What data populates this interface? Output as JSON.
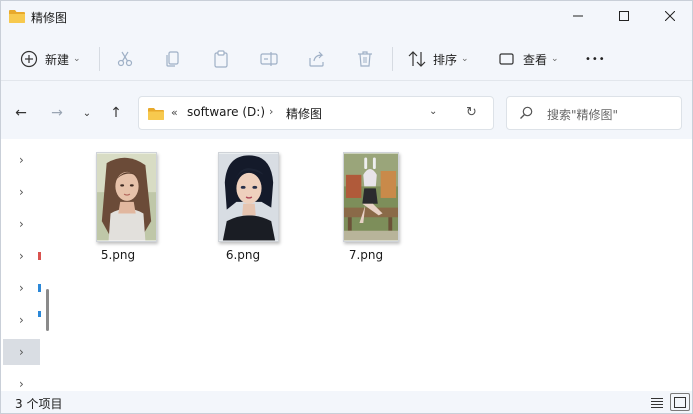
{
  "window": {
    "title": "精修图"
  },
  "commands": {
    "new_label": "新建",
    "sort_label": "排序",
    "view_label": "查看",
    "more_label": "•••"
  },
  "address": {
    "overflow": "«",
    "crumbs": [
      "software (D:)",
      "精修图"
    ]
  },
  "search": {
    "placeholder": "搜索\"精修图\""
  },
  "files": [
    {
      "name": "5.png"
    },
    {
      "name": "6.png"
    },
    {
      "name": "7.png"
    }
  ],
  "status": {
    "text": "3 个项目"
  },
  "colors": {
    "folder": "#f2c14e",
    "accent": "#0067c0"
  }
}
